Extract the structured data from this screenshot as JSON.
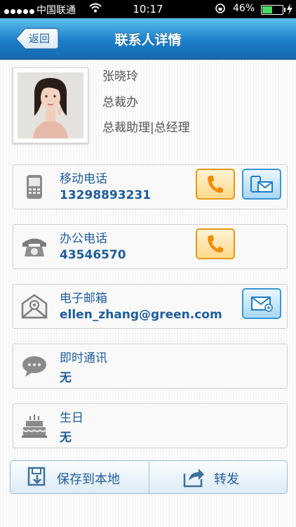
{
  "status_bar": {
    "carrier": "中国联通",
    "time": "10:17",
    "battery": "46%"
  },
  "nav": {
    "back_label": "返回",
    "title": "联系人详情"
  },
  "profile": {
    "name": "张晓玲",
    "department": "总裁办",
    "position": "总裁助理|总经理"
  },
  "fields": [
    {
      "label": "移动电话",
      "value": "13298893231"
    },
    {
      "label": "办公电话",
      "value": "43546570"
    },
    {
      "label": "电子邮箱",
      "value": "ellen_zhang@green.com"
    },
    {
      "label": "即时通讯",
      "value": "无"
    },
    {
      "label": "生日",
      "value": "无"
    }
  ],
  "actions": {
    "save_local": "保存到本地",
    "forward": "转发"
  },
  "colors": {
    "nav_blue": "#1b7ec8",
    "text_blue": "#1f5d9c",
    "call_orange": "#e39a17",
    "msg_blue": "#3b96d4"
  }
}
